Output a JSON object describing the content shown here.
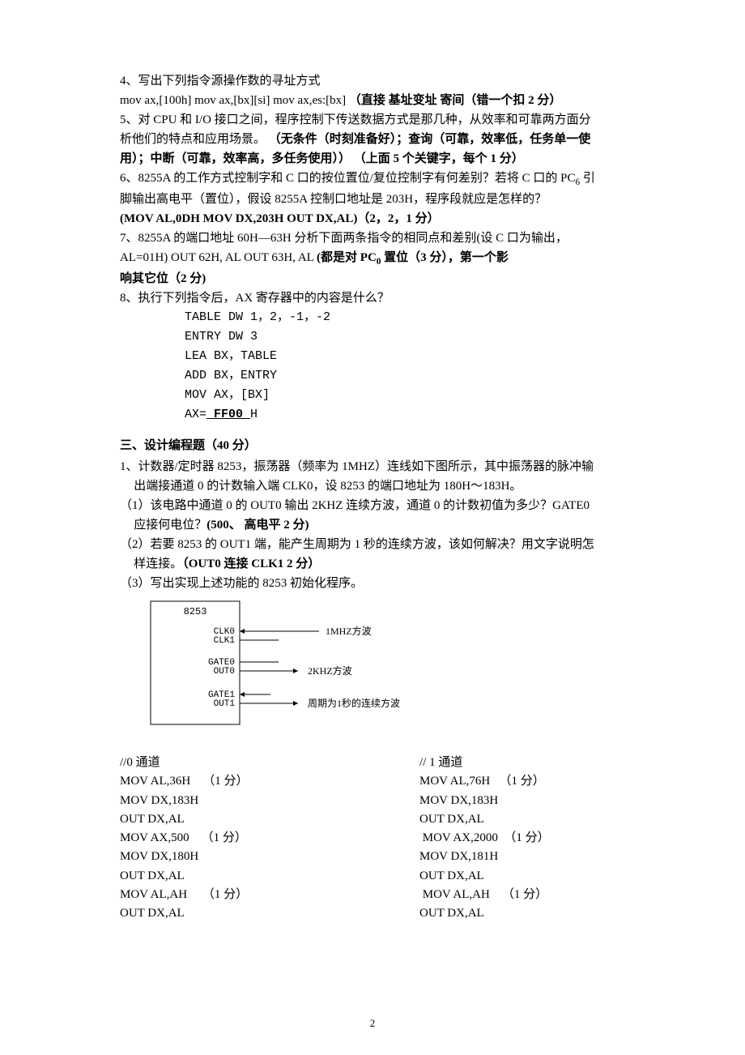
{
  "q4": {
    "prompt": "4、写出下列指令源操作数的寻址方式",
    "line2_a": "mov ax,[100h]   mov ax,[bx][si]   mov ax,es:[bx]  ",
    "line2_b": "（直接  基址变址  寄间（错一个扣 2 分）"
  },
  "q5": {
    "line1": "5、对 CPU 和 I/O 接口之间，程序控制下传送数据方式是那几种，从效率和可靠两方面分",
    "line2_a": "析他们的特点和应用场景。 ",
    "line2_b": "（无条件（时刻准备好）；查询（可靠，效率低，任务单一使",
    "line3": "用）；中断（可靠，效率高，多任务使用）） （上面 5 个关键字，每个 1 分）"
  },
  "q6": {
    "line1_a": "6、8255A 的工作方式控制字和 C 口的按位置位/复位控制字有何差别？若将 C 口的 PC",
    "line1_sub": "6",
    "line1_b": " 引",
    "line2": "脚输出高电平（置位），假设 8255A 控制口地址是 203H，程序段就应是怎样的？",
    "line3": "(MOV AL,0DH    MOV   DX,203H   OUT DX,AL)（2，2，1 分）"
  },
  "q7": {
    "line1": "7、8255A 的端口地址 60H—63H  分析下面两条指令的相同点和差别(设 C 口为输出，",
    "line2_a": "AL=01H)     OUT   62H, AL        OUT    63H, AL   ",
    "line2_b": "(都是对 PC",
    "line2_sub": "0",
    "line2_c": " 置位（3 分），第一个影",
    "line3": "响其它位（2 分)"
  },
  "q8": {
    "line1": "8、执行下列指令后，AX 寄存器中的内容是什么？",
    "code": [
      "TABLE  DW  1，2，-1，-2",
      "ENTRY  DW  3",
      "LEA   BX，TABLE",
      "ADD   BX，ENTRY",
      "MOV  AX，[BX]"
    ],
    "ax_label": "AX=",
    "ax_value": "  FF00  ",
    "ax_tail": "H"
  },
  "section3": {
    "title": "三、设计编程题（40 分）",
    "q1_l1": "1、计数器/定时器 8253，振荡器（频率为 1MHZ）连线如下图所示，其中振荡器的脉冲输",
    "q1_l2": "出端接通道 0 的计数输入端 CLK0，设 8253 的端口地址为 180H～183H。",
    "q1_sub1_l1": "（1）该电路中通道 0 的 OUT0 输出 2KHZ 连续方波，通道 0 的计数初值为多少？GATE0",
    "q1_sub1_l2_a": "应接何电位？",
    "q1_sub1_l2_b": "(500、 高电平     2 分)",
    "q1_sub2_l1": "（2）若要 8253 的 OUT1 端，能产生周期为 1 秒的连续方波，该如何解决？用文字说明怎",
    "q1_sub2_l2_a": "样连接。",
    "q1_sub2_l2_b": "（OUT0 连接 CLK1    2 分）",
    "q1_sub3": "（3）写出实现上述功能的 8253 初始化程序。"
  },
  "diagram": {
    "chip": "8253",
    "pins": [
      "CLK0",
      "CLK1",
      "GATE0",
      "OUT0",
      "GATE1",
      "OUT1"
    ],
    "labels": [
      "1MHZ方波",
      "2KHZ方波",
      "周期为1秒的连续方波"
    ]
  },
  "code_cols": {
    "left_title": "//0 通道",
    "right_title": "// 1 通道",
    "left": [
      "MOV AL,36H    （1 分）",
      "MOV DX,183H",
      "OUT DX,AL",
      "MOV AX,500    （1 分）",
      "MOV DX,180H",
      "OUT DX,AL",
      "MOV AL,AH     （1 分）",
      "OUT DX,AL"
    ],
    "right": [
      "MOV AL,76H   （1 分）",
      "MOV DX,183H",
      "OUT DX,AL",
      " MOV AX,2000  （1 分）",
      "MOV DX,181H",
      "OUT DX,AL",
      " MOV AL,AH    （1 分）",
      "OUT DX,AL"
    ]
  },
  "page_number": "2"
}
